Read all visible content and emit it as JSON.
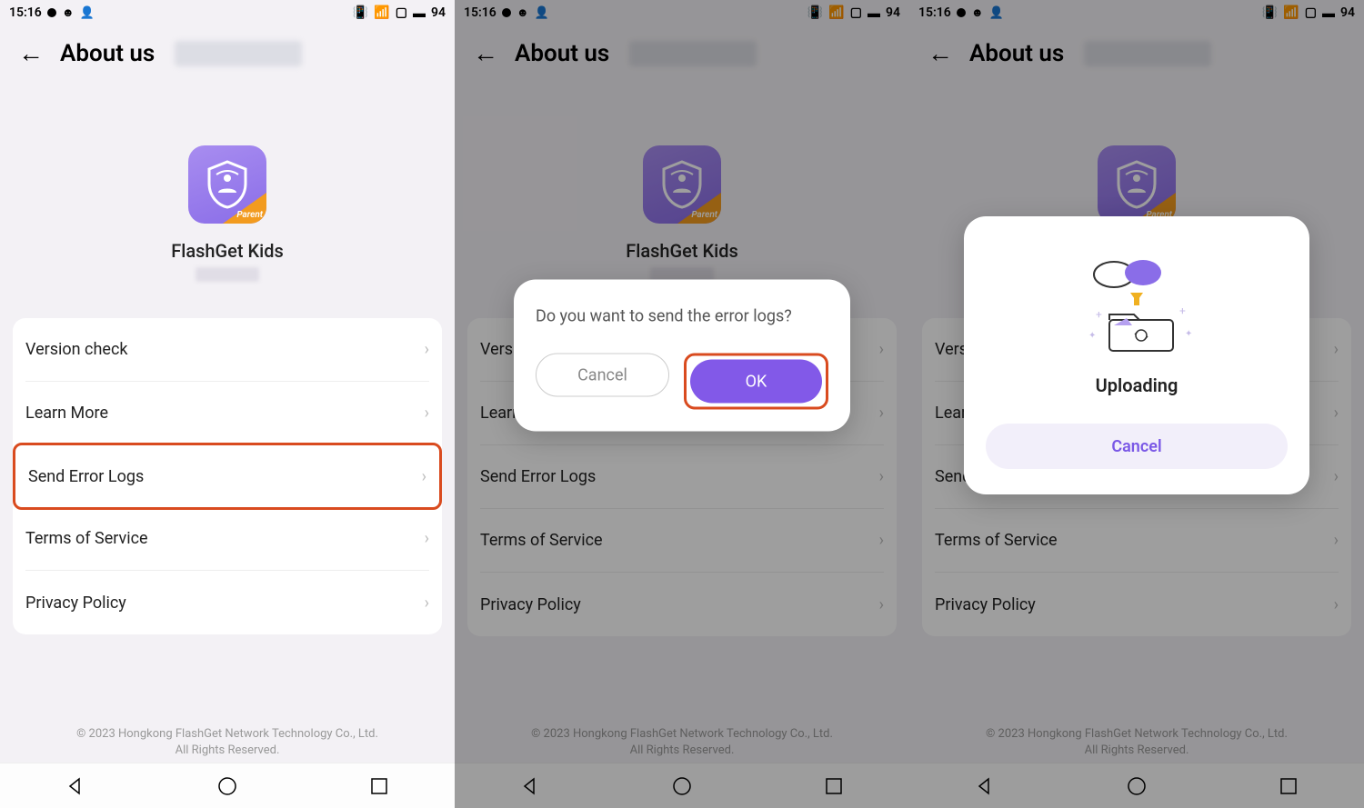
{
  "status": {
    "time": "15:16",
    "battery": "94"
  },
  "header": {
    "title": "About us"
  },
  "app": {
    "name": "FlashGet Kids",
    "parent_label": "Parent"
  },
  "menu": {
    "version_check": "Version check",
    "learn_more": "Learn More",
    "send_error_logs": "Send Error Logs",
    "terms": "Terms of Service",
    "privacy": "Privacy Policy"
  },
  "footer": {
    "line1": "© 2023 Hongkong FlashGet Network Technology Co., Ltd.",
    "line2": "All Rights Reserved."
  },
  "dialog_confirm": {
    "message": "Do you want to send the error logs?",
    "cancel": "Cancel",
    "ok": "OK"
  },
  "dialog_upload": {
    "title": "Uploading",
    "cancel": "Cancel"
  }
}
